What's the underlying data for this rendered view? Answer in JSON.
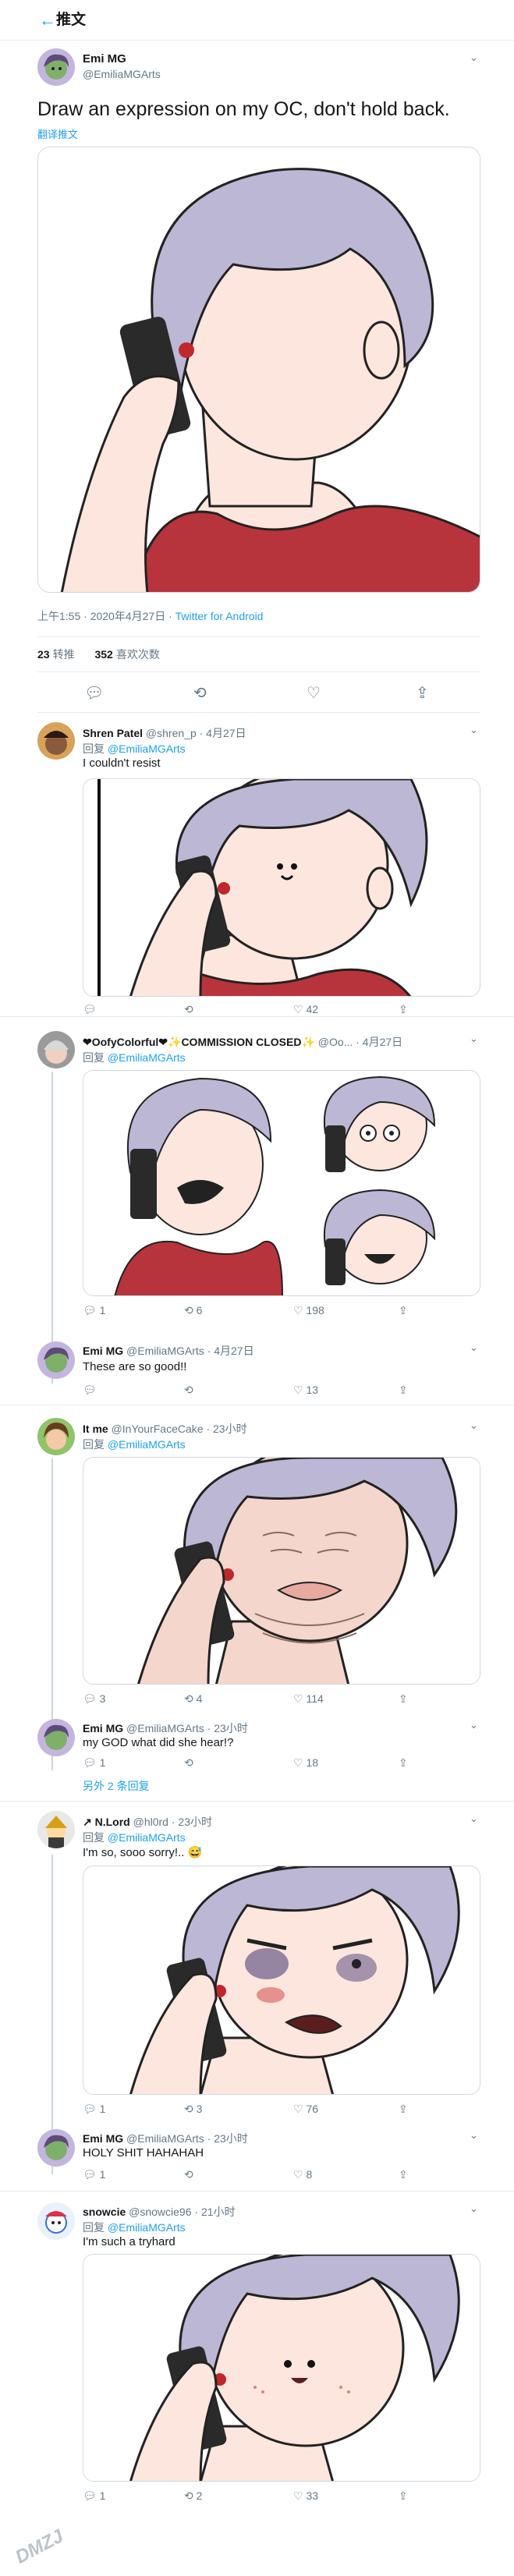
{
  "header": {
    "back_icon": "arrow-left-icon",
    "title": "推文"
  },
  "main_tweet": {
    "name": "Emi MG",
    "handle": "@EmiliaMGArts",
    "text": "Draw an expression on my OC, don't hold back.",
    "translate": "翻译推文",
    "timestamp": "上午1:55 · 2020年4月27日 · ",
    "source": "Twitter for Android",
    "retweets_count": "23",
    "retweets_label": "转推",
    "likes_count": "352",
    "likes_label": "喜欢次数"
  },
  "replies": [
    {
      "name": "Shren Patel",
      "handle": "@shren_p · 4月27日",
      "reply_prefix": "回复 ",
      "reply_to": "@EmiliaMGArts",
      "text": "I couldn't resist",
      "replies": "",
      "retweets": "",
      "likes": "42"
    },
    {
      "name": "❤OofyColorful❤✨COMMISSION CLOSED✨",
      "handle": "@Oo... · 4月27日",
      "reply_prefix": "回复 ",
      "reply_to": "@EmiliaMGArts",
      "text": "",
      "replies": "1",
      "retweets": "6",
      "likes": "198"
    },
    {
      "name": "Emi MG",
      "handle": "@EmiliaMGArts · 4月27日",
      "text": "These are so good!!",
      "replies": "",
      "retweets": "",
      "likes": "13"
    },
    {
      "name": "It me",
      "handle": "@InYourFaceCake · 23小时",
      "reply_prefix": "回复 ",
      "reply_to": "@EmiliaMGArts",
      "text": "",
      "replies": "3",
      "retweets": "4",
      "likes": "114"
    },
    {
      "name": "Emi MG",
      "handle": "@EmiliaMGArts · 23小时",
      "text": "my GOD what did she hear!?",
      "replies": "1",
      "retweets": "",
      "likes": "18",
      "more_replies": "另外 2 条回复"
    },
    {
      "name": "↗ N.Lord",
      "handle": "@hl0rd · 23小时",
      "reply_prefix": "回复 ",
      "reply_to": "@EmiliaMGArts",
      "text": "I'm so, sooo sorry!.. 😅",
      "replies": "1",
      "retweets": "3",
      "likes": "76"
    },
    {
      "name": "Emi MG",
      "handle": "@EmiliaMGArts · 23小时",
      "text": "HOLY SHIT HAHAHAH",
      "replies": "1",
      "retweets": "",
      "likes": "8"
    },
    {
      "name": "snowcie",
      "handle": "@snowcie96 · 21小时",
      "reply_prefix": "回复 ",
      "reply_to": "@EmiliaMGArts",
      "text": "I'm such a tryhard",
      "replies": "1",
      "retweets": "2",
      "likes": "33"
    }
  ],
  "icons": {
    "reply": "reply-icon",
    "retweet": "retweet-icon",
    "like": "heart-icon",
    "share": "share-icon",
    "more": "chevron-down-icon"
  },
  "colors": {
    "accent": "#1da1f2",
    "shirt": "#b8343c",
    "hair": "#bdb7d6",
    "skin": "#fde6de",
    "phone": "#2a2a2a"
  },
  "watermark": "DMZJ"
}
